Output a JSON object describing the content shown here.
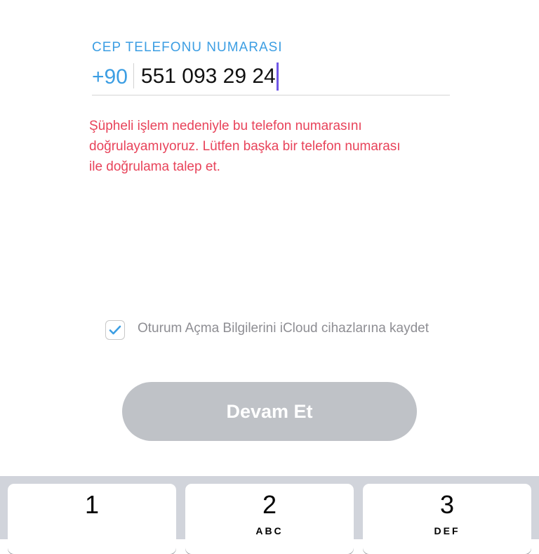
{
  "phone_form": {
    "label": "CEP TELEFONU NUMARASI",
    "country_code": "+90",
    "phone_number": "551 093 29 24"
  },
  "error_message": "Şüpheli işlem nedeniyle bu telefon numarasını doğrulayamıyoruz. Lütfen başka bir telefon numarası ile doğrulama talep et.",
  "remember_login": {
    "checked": true,
    "label": "Oturum Açma Bilgilerini iCloud cihazlarına kaydet"
  },
  "continue_button": {
    "label": "Devam Et"
  },
  "keypad": {
    "keys": [
      {
        "number": "1",
        "letters": ""
      },
      {
        "number": "2",
        "letters": "ABC"
      },
      {
        "number": "3",
        "letters": "DEF"
      }
    ]
  },
  "colors": {
    "accent": "#3c9ee3",
    "error": "#e8435a",
    "caret": "#6f57e6",
    "button_disabled": "#bfc2c7",
    "keypad_background": "#d1d4db"
  },
  "icons": {
    "checkbox": "checkmark-icon"
  }
}
